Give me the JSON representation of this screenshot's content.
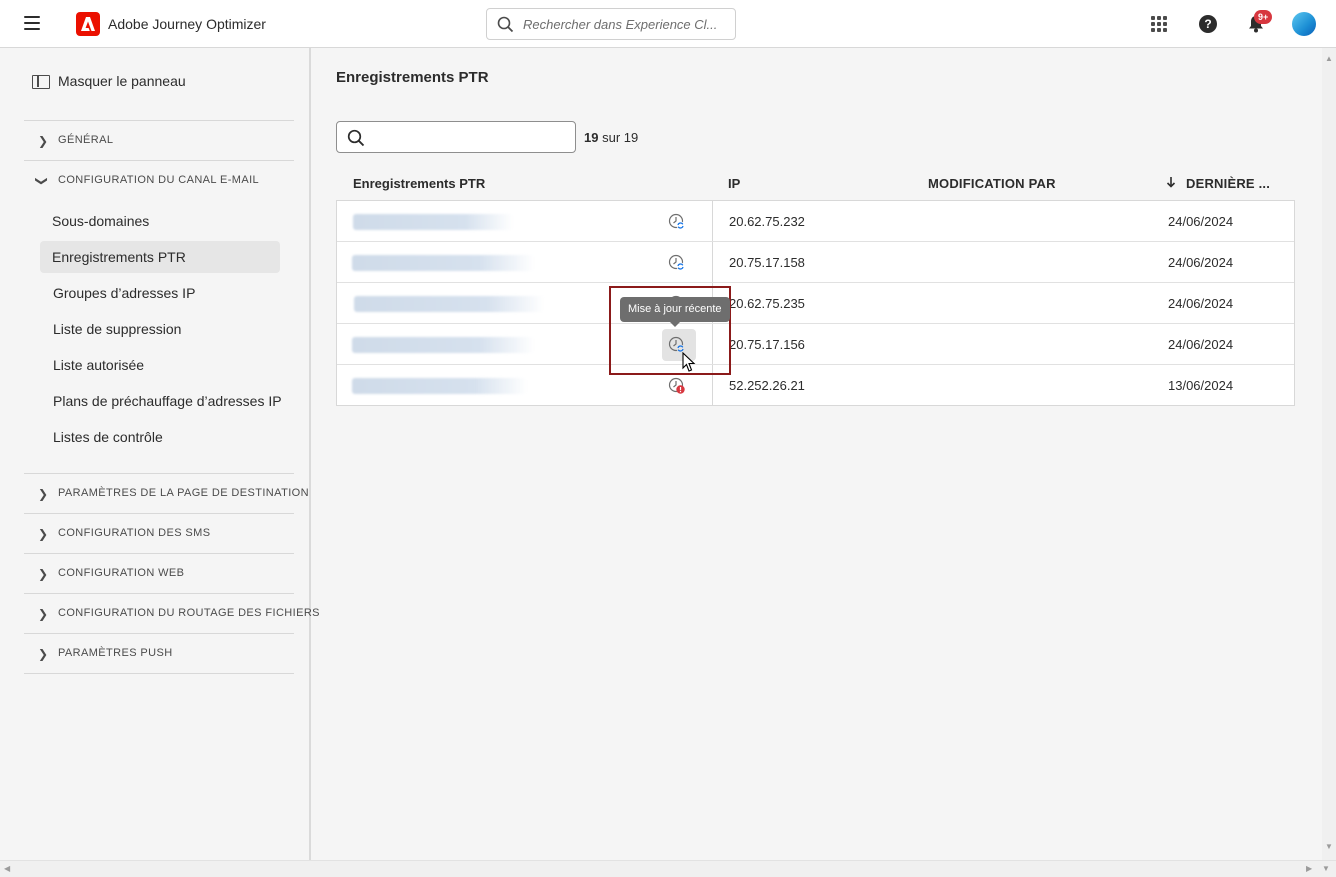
{
  "topbar": {
    "app_title": "Adobe Journey Optimizer",
    "search_placeholder": "Rechercher dans Experience Cl...",
    "notification_badge": "9+",
    "help_glyph": "?"
  },
  "sidebar": {
    "hide_panel_label": "Masquer le panneau",
    "sections": [
      {
        "label": "GÉNÉRAL",
        "expanded": false
      },
      {
        "label": "CONFIGURATION DU CANAL E-MAIL",
        "expanded": true
      },
      {
        "label": "PARAMÈTRES DE LA PAGE DE DESTINATION",
        "expanded": false
      },
      {
        "label": "CONFIGURATION DES SMS",
        "expanded": false
      },
      {
        "label": "CONFIGURATION WEB",
        "expanded": false
      },
      {
        "label": "CONFIGURATION DU ROUTAGE DES FICHIERS",
        "expanded": false
      },
      {
        "label": "PARAMÈTRES PUSH",
        "expanded": false
      }
    ],
    "email_items": [
      {
        "label": "Sous-domaines",
        "active": false
      },
      {
        "label": "Enregistrements PTR",
        "active": true
      },
      {
        "label": "Groupes d’adresses IP",
        "active": false
      },
      {
        "label": "Liste de suppression",
        "active": false
      },
      {
        "label": "Liste autorisée",
        "active": false
      },
      {
        "label": "Plans de préchauffage d’adresses IP",
        "active": false
      },
      {
        "label": "Listes de contrôle",
        "active": false
      }
    ]
  },
  "main": {
    "title": "Enregistrements PTR",
    "count_current": "19",
    "count_suffix": "sur 19",
    "columns": {
      "name": "Enregistrements PTR",
      "ip": "IP",
      "modified_by": "MODIFICATION PAR",
      "last": "DERNIÈRE ..."
    },
    "rows": [
      {
        "ip": "20.62.75.232",
        "date": "24/06/2024",
        "status": "recent-update"
      },
      {
        "ip": "20.75.17.158",
        "date": "24/06/2024",
        "status": "recent-update"
      },
      {
        "ip": "20.62.75.235",
        "date": "24/06/2024",
        "status": "recent-update"
      },
      {
        "ip": "20.75.17.156",
        "date": "24/06/2024",
        "status": "recent-update"
      },
      {
        "ip": "52.252.26.21",
        "date": "13/06/2024",
        "status": "error"
      }
    ],
    "tooltip": "Mise à jour récente"
  },
  "colors": {
    "accent_red": "#eb1000",
    "badge_red": "#d7373f",
    "highlight_border": "#8b1a1a",
    "status_blue": "#1473e6"
  }
}
